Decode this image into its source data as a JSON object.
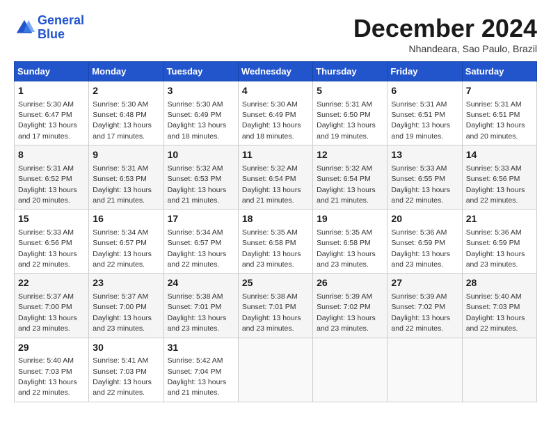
{
  "logo": {
    "line1": "General",
    "line2": "Blue"
  },
  "title": "December 2024",
  "subtitle": "Nhandeara, Sao Paulo, Brazil",
  "days_header": [
    "Sunday",
    "Monday",
    "Tuesday",
    "Wednesday",
    "Thursday",
    "Friday",
    "Saturday"
  ],
  "weeks": [
    [
      {
        "day": "1",
        "sunrise": "5:30 AM",
        "sunset": "6:47 PM",
        "daylight": "13 hours and 17 minutes."
      },
      {
        "day": "2",
        "sunrise": "5:30 AM",
        "sunset": "6:48 PM",
        "daylight": "13 hours and 17 minutes."
      },
      {
        "day": "3",
        "sunrise": "5:30 AM",
        "sunset": "6:49 PM",
        "daylight": "13 hours and 18 minutes."
      },
      {
        "day": "4",
        "sunrise": "5:30 AM",
        "sunset": "6:49 PM",
        "daylight": "13 hours and 18 minutes."
      },
      {
        "day": "5",
        "sunrise": "5:31 AM",
        "sunset": "6:50 PM",
        "daylight": "13 hours and 19 minutes."
      },
      {
        "day": "6",
        "sunrise": "5:31 AM",
        "sunset": "6:51 PM",
        "daylight": "13 hours and 19 minutes."
      },
      {
        "day": "7",
        "sunrise": "5:31 AM",
        "sunset": "6:51 PM",
        "daylight": "13 hours and 20 minutes."
      }
    ],
    [
      {
        "day": "8",
        "sunrise": "5:31 AM",
        "sunset": "6:52 PM",
        "daylight": "13 hours and 20 minutes."
      },
      {
        "day": "9",
        "sunrise": "5:31 AM",
        "sunset": "6:53 PM",
        "daylight": "13 hours and 21 minutes."
      },
      {
        "day": "10",
        "sunrise": "5:32 AM",
        "sunset": "6:53 PM",
        "daylight": "13 hours and 21 minutes."
      },
      {
        "day": "11",
        "sunrise": "5:32 AM",
        "sunset": "6:54 PM",
        "daylight": "13 hours and 21 minutes."
      },
      {
        "day": "12",
        "sunrise": "5:32 AM",
        "sunset": "6:54 PM",
        "daylight": "13 hours and 21 minutes."
      },
      {
        "day": "13",
        "sunrise": "5:33 AM",
        "sunset": "6:55 PM",
        "daylight": "13 hours and 22 minutes."
      },
      {
        "day": "14",
        "sunrise": "5:33 AM",
        "sunset": "6:56 PM",
        "daylight": "13 hours and 22 minutes."
      }
    ],
    [
      {
        "day": "15",
        "sunrise": "5:33 AM",
        "sunset": "6:56 PM",
        "daylight": "13 hours and 22 minutes."
      },
      {
        "day": "16",
        "sunrise": "5:34 AM",
        "sunset": "6:57 PM",
        "daylight": "13 hours and 22 minutes."
      },
      {
        "day": "17",
        "sunrise": "5:34 AM",
        "sunset": "6:57 PM",
        "daylight": "13 hours and 22 minutes."
      },
      {
        "day": "18",
        "sunrise": "5:35 AM",
        "sunset": "6:58 PM",
        "daylight": "13 hours and 23 minutes."
      },
      {
        "day": "19",
        "sunrise": "5:35 AM",
        "sunset": "6:58 PM",
        "daylight": "13 hours and 23 minutes."
      },
      {
        "day": "20",
        "sunrise": "5:36 AM",
        "sunset": "6:59 PM",
        "daylight": "13 hours and 23 minutes."
      },
      {
        "day": "21",
        "sunrise": "5:36 AM",
        "sunset": "6:59 PM",
        "daylight": "13 hours and 23 minutes."
      }
    ],
    [
      {
        "day": "22",
        "sunrise": "5:37 AM",
        "sunset": "7:00 PM",
        "daylight": "13 hours and 23 minutes."
      },
      {
        "day": "23",
        "sunrise": "5:37 AM",
        "sunset": "7:00 PM",
        "daylight": "13 hours and 23 minutes."
      },
      {
        "day": "24",
        "sunrise": "5:38 AM",
        "sunset": "7:01 PM",
        "daylight": "13 hours and 23 minutes."
      },
      {
        "day": "25",
        "sunrise": "5:38 AM",
        "sunset": "7:01 PM",
        "daylight": "13 hours and 23 minutes."
      },
      {
        "day": "26",
        "sunrise": "5:39 AM",
        "sunset": "7:02 PM",
        "daylight": "13 hours and 23 minutes."
      },
      {
        "day": "27",
        "sunrise": "5:39 AM",
        "sunset": "7:02 PM",
        "daylight": "13 hours and 22 minutes."
      },
      {
        "day": "28",
        "sunrise": "5:40 AM",
        "sunset": "7:03 PM",
        "daylight": "13 hours and 22 minutes."
      }
    ],
    [
      {
        "day": "29",
        "sunrise": "5:40 AM",
        "sunset": "7:03 PM",
        "daylight": "13 hours and 22 minutes."
      },
      {
        "day": "30",
        "sunrise": "5:41 AM",
        "sunset": "7:03 PM",
        "daylight": "13 hours and 22 minutes."
      },
      {
        "day": "31",
        "sunrise": "5:42 AM",
        "sunset": "7:04 PM",
        "daylight": "13 hours and 21 minutes."
      },
      null,
      null,
      null,
      null
    ]
  ]
}
